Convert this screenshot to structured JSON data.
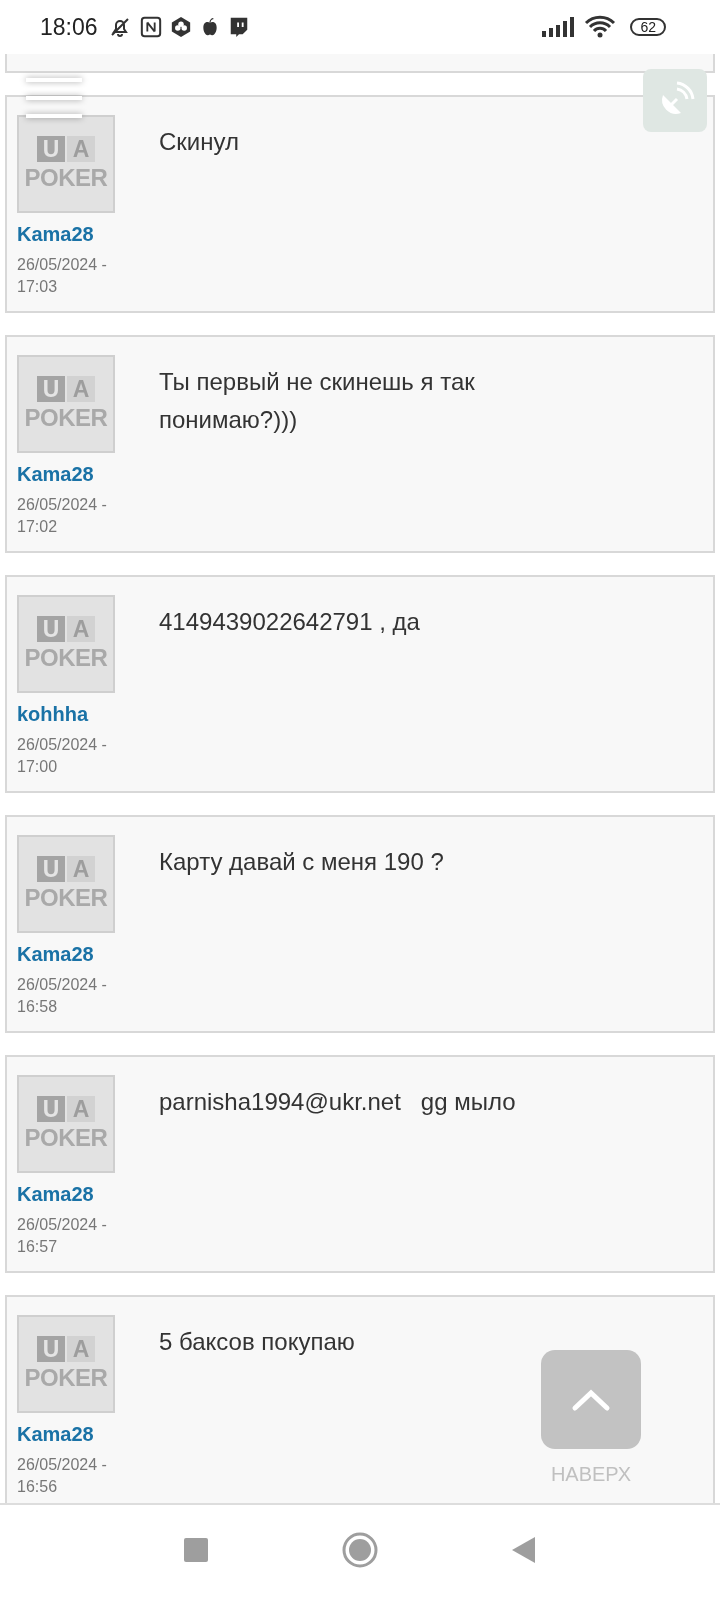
{
  "status_bar": {
    "time": "18:06",
    "battery": "62"
  },
  "messages": [
    {
      "avatar": {
        "letters": [
          "U",
          "A"
        ],
        "caption": "POKER"
      },
      "author": "Kama28",
      "date": "26/05/2024 - 17:03",
      "text": "Скинул"
    },
    {
      "avatar": {
        "letters": [
          "U",
          "A"
        ],
        "caption": "POKER"
      },
      "author": "Kama28",
      "date": "26/05/2024 - 17:02",
      "text": "Ты первый не скинешь я так понимаю?)))"
    },
    {
      "avatar": {
        "letters": [
          "U",
          "A"
        ],
        "caption": "POKER"
      },
      "author": "kohhha",
      "date": "26/05/2024 - 17:00",
      "text": "4149439022642791 , да"
    },
    {
      "avatar": {
        "letters": [
          "U",
          "A"
        ],
        "caption": "POKER"
      },
      "author": "Kama28",
      "date": "26/05/2024 - 16:58",
      "text": "Карту давай с меня 190 ?"
    },
    {
      "avatar": {
        "letters": [
          "U",
          "A"
        ],
        "caption": "POKER"
      },
      "author": "Kama28",
      "date": "26/05/2024 - 16:57",
      "text": "parnisha1994@ukr.net   gg мыло"
    },
    {
      "avatar": {
        "letters": [
          "U",
          "A"
        ],
        "caption": "POKER"
      },
      "author": "Kama28",
      "date": "26/05/2024 - 16:56",
      "text": "5 баксов покупаю"
    }
  ],
  "scroll_top": {
    "label": "НАВЕРХ"
  }
}
